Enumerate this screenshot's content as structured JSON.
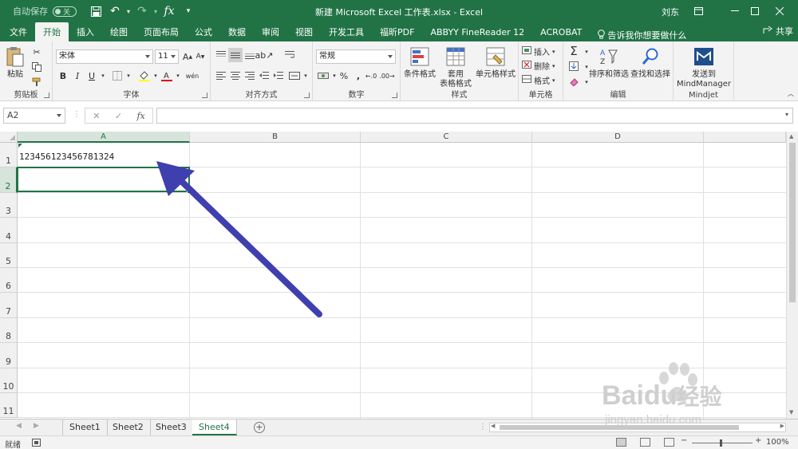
{
  "titlebar": {
    "autosave_label": "自动保存",
    "autosave_state": "关",
    "title": "新建 Microsoft Excel 工作表.xlsx  -  Excel",
    "user": "刘东"
  },
  "tabs": [
    "文件",
    "开始",
    "插入",
    "绘图",
    "页面布局",
    "公式",
    "数据",
    "审阅",
    "视图",
    "开发工具",
    "福昕PDF",
    "ABBYY FineReader 12",
    "ACROBAT"
  ],
  "active_tab": "开始",
  "tell_me": "告诉我你想要做什么",
  "share": "共享",
  "ribbon": {
    "clipboard": {
      "label": "剪贴板",
      "paste": "粘贴"
    },
    "font": {
      "label": "字体",
      "name": "宋体",
      "size": "11"
    },
    "alignment": {
      "label": "对齐方式"
    },
    "number": {
      "label": "数字",
      "format": "常规"
    },
    "styles": {
      "label": "样式",
      "conditional": "条件格式",
      "table_a": "套用",
      "table_b": "表格格式",
      "cell_styles": "单元格样式"
    },
    "cells": {
      "label": "单元格",
      "insert": "插入",
      "delete": "删除",
      "format": "格式"
    },
    "editing": {
      "label": "编辑",
      "sort": "排序和筛选",
      "find": "查找和选择"
    },
    "mindjet": {
      "label": "Mindjet",
      "send_a": "发送到",
      "send_b": "MindManager"
    }
  },
  "formula_bar": {
    "name_box": "A2",
    "formula": ""
  },
  "columns": [
    "A",
    "B",
    "C",
    "D"
  ],
  "rows": [
    "1",
    "2",
    "3",
    "4",
    "5",
    "6",
    "7",
    "8",
    "9",
    "10",
    "11"
  ],
  "cells": {
    "A1": "123456123456781324"
  },
  "selected_cell": "A2",
  "sheets": [
    "Sheet1",
    "Sheet2",
    "Sheet3",
    "Sheet4"
  ],
  "active_sheet": "Sheet4",
  "status": {
    "ready": "就绪",
    "zoom": "100%"
  },
  "colors": {
    "accent": "#217346",
    "arrow": "#3f3fb0"
  },
  "watermark": {
    "brand": "Baidu",
    "brand_cn": "经验",
    "url": "jingyan.baidu.com"
  }
}
